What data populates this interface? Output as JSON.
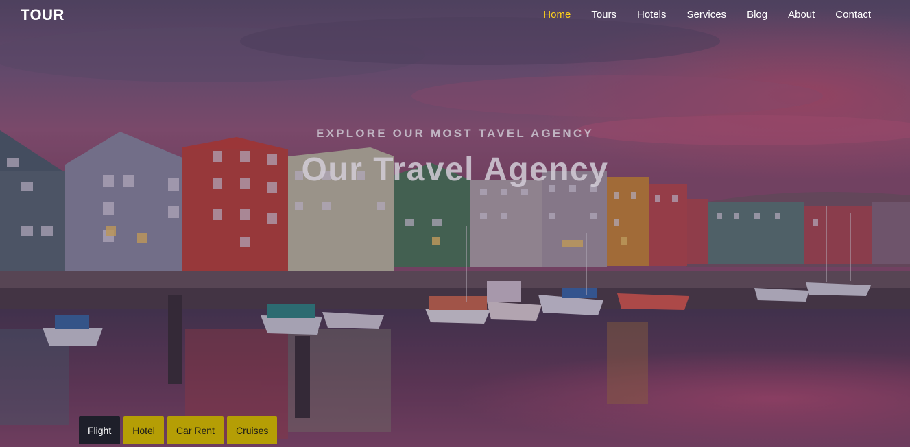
{
  "brand": {
    "logo": "TOUR"
  },
  "nav": {
    "items": [
      {
        "label": "Home",
        "active": true
      },
      {
        "label": "Tours",
        "active": false
      },
      {
        "label": "Hotels",
        "active": false
      },
      {
        "label": "Services",
        "active": false
      },
      {
        "label": "Blog",
        "active": false
      },
      {
        "label": "About",
        "active": false
      },
      {
        "label": "Contact",
        "active": false
      }
    ]
  },
  "hero": {
    "subtitle": "EXPLORE OUR MOST TAVEL AGENCY",
    "title": "Our Travel Agency"
  },
  "search_tabs": [
    {
      "label": "Flight",
      "active": true
    },
    {
      "label": "Hotel",
      "active": false
    },
    {
      "label": "Car Rent",
      "active": false
    },
    {
      "label": "Cruises",
      "active": false
    }
  ],
  "colors": {
    "nav_active": "#ffd21a",
    "tab_active_bg": "#1e1f2a",
    "tab_inactive_bg": "#b59e05"
  }
}
